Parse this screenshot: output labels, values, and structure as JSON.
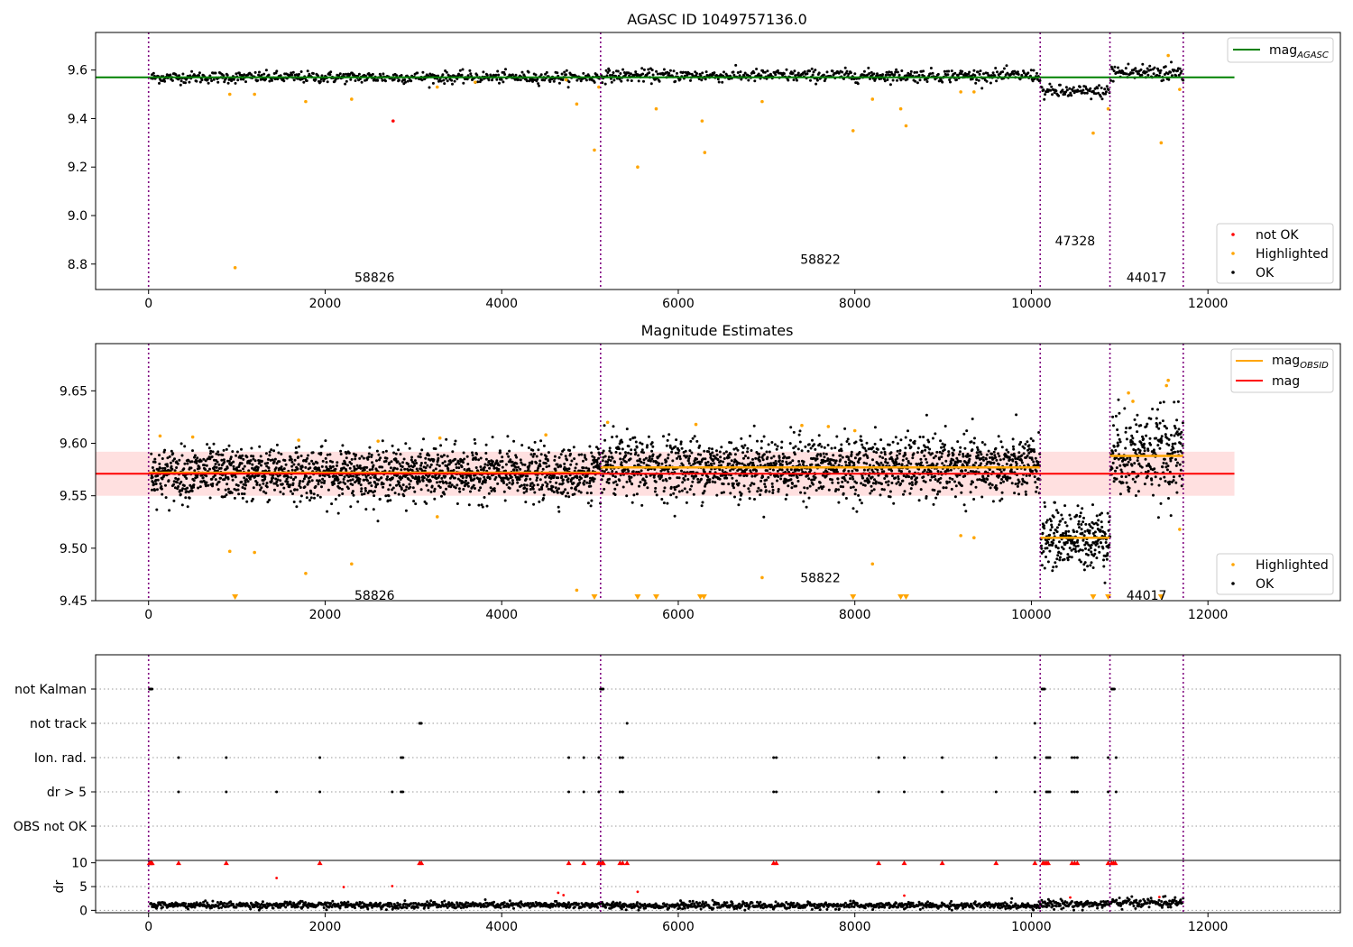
{
  "chart_data": [
    {
      "type": "scatter",
      "title": "AGASC ID 1049757136.0",
      "xlim": [
        -600,
        13500
      ],
      "ylim": [
        8.695,
        9.755
      ],
      "xticks": [
        0,
        2000,
        4000,
        6000,
        8000,
        10000,
        12000
      ],
      "yticks": [
        8.8,
        9.0,
        9.2,
        9.4,
        9.6
      ],
      "observation_boundaries": [
        0,
        5120,
        10100,
        10890,
        11720
      ],
      "observation_labels": [
        {
          "text": "58826",
          "x": 2560,
          "y": 8.745
        },
        {
          "text": "58822",
          "x": 7610,
          "y": 8.82
        },
        {
          "text": "47328",
          "x": 10495,
          "y": 8.895
        },
        {
          "text": "44017",
          "x": 11305,
          "y": 8.745
        }
      ],
      "reference_line": {
        "name": "mag_AGASC",
        "y": 9.57,
        "x_range": [
          -600,
          12300
        ],
        "color": "#008000"
      },
      "ok_segments": [
        {
          "x": [
            30,
            5120
          ],
          "center": 9.57,
          "spread": 0.012
        },
        {
          "x": [
            5130,
            10100
          ],
          "center": 9.577,
          "spread": 0.013
        },
        {
          "x": [
            10110,
            10890
          ],
          "center": 9.51,
          "spread": 0.014
        },
        {
          "x": [
            10900,
            11720
          ],
          "center": 9.59,
          "spread": 0.02
        }
      ],
      "highlighted_points": [
        [
          980,
          8.785
        ],
        [
          4850,
          9.46
        ],
        [
          5050,
          9.27
        ],
        [
          5540,
          9.2
        ],
        [
          5750,
          9.44
        ],
        [
          6270,
          9.39
        ],
        [
          6300,
          9.26
        ],
        [
          6950,
          9.47
        ],
        [
          7980,
          9.35
        ],
        [
          8200,
          9.48
        ],
        [
          8520,
          9.44
        ],
        [
          8580,
          9.37
        ],
        [
          9200,
          9.51
        ],
        [
          9350,
          9.51
        ],
        [
          10700,
          9.34
        ],
        [
          10870,
          9.44
        ],
        [
          11470,
          9.3
        ],
        [
          11550,
          9.66
        ],
        [
          11680,
          9.52
        ],
        [
          920,
          9.5
        ],
        [
          1200,
          9.5
        ],
        [
          1780,
          9.47
        ],
        [
          2300,
          9.48
        ],
        [
          3270,
          9.53
        ],
        [
          3700,
          9.55
        ],
        [
          4730,
          9.56
        ],
        [
          5100,
          9.53
        ]
      ],
      "not_ok_points": [
        [
          2770,
          9.39
        ]
      ],
      "legend_upper": [
        "mag_AGASC"
      ],
      "legend_lower": [
        "not OK",
        "Highlighted",
        "OK"
      ],
      "legend_upper_position": "upper right",
      "legend_lower_position": "lower right"
    },
    {
      "type": "scatter",
      "title": "Magnitude Estimates",
      "xlim": [
        -600,
        13500
      ],
      "ylim": [
        9.45,
        9.695
      ],
      "xticks": [
        0,
        2000,
        4000,
        6000,
        8000,
        10000,
        12000
      ],
      "yticks": [
        9.45,
        9.5,
        9.55,
        9.6,
        9.65
      ],
      "observation_boundaries": [
        0,
        5120,
        10100,
        10890,
        11720
      ],
      "observation_labels": [
        {
          "text": "58826",
          "x": 2560,
          "y": 9.455
        },
        {
          "text": "58822",
          "x": 7610,
          "y": 9.472
        },
        {
          "text": "44017",
          "x": 11305,
          "y": 9.455
        }
      ],
      "mean_line": {
        "name": "mag",
        "y": 9.571,
        "x_range": [
          -600,
          12300
        ],
        "band": [
          9.55,
          9.592
        ],
        "color": "#ff0000"
      },
      "obsid_lines": [
        {
          "x_range": [
            0,
            5120
          ],
          "y": 9.572
        },
        {
          "x_range": [
            5120,
            10100
          ],
          "y": 9.577
        },
        {
          "x_range": [
            10100,
            10890
          ],
          "y": 9.51
        },
        {
          "x_range": [
            10890,
            11720
          ],
          "y": 9.588
        }
      ],
      "ok_segments": [
        {
          "x": [
            30,
            5120
          ],
          "center": 9.571,
          "spread": 0.012
        },
        {
          "x": [
            5130,
            10100
          ],
          "center": 9.577,
          "spread": 0.014
        },
        {
          "x": [
            10110,
            10890
          ],
          "center": 9.51,
          "spread": 0.014
        },
        {
          "x": [
            10900,
            11720
          ],
          "center": 9.59,
          "spread": 0.02
        }
      ],
      "highlighted_points": [
        [
          920,
          9.497
        ],
        [
          1200,
          9.496
        ],
        [
          1780,
          9.476
        ],
        [
          2300,
          9.485
        ],
        [
          3270,
          9.53
        ],
        [
          4850,
          9.46
        ],
        [
          6950,
          9.472
        ],
        [
          8200,
          9.485
        ],
        [
          9200,
          9.512
        ],
        [
          9350,
          9.51
        ],
        [
          11680,
          9.518
        ],
        [
          11550,
          9.66
        ],
        [
          11530,
          9.655
        ],
        [
          11100,
          9.648
        ],
        [
          11150,
          9.64
        ],
        [
          6200,
          9.618
        ],
        [
          7400,
          9.617
        ],
        [
          7700,
          9.616
        ],
        [
          5200,
          9.62
        ],
        [
          130,
          9.607
        ],
        [
          500,
          9.606
        ],
        [
          1700,
          9.603
        ],
        [
          2600,
          9.602
        ],
        [
          3300,
          9.605
        ],
        [
          4500,
          9.608
        ],
        [
          8000,
          9.612
        ]
      ],
      "clipped_points_x": [
        980,
        5050,
        5540,
        5750,
        6250,
        6290,
        7980,
        8520,
        8580,
        10700,
        10870,
        11470
      ],
      "legend_upper": [
        "mag_OBSID",
        "mag"
      ],
      "legend_lower": [
        "Highlighted",
        "OK"
      ],
      "legend_upper_position": "upper right",
      "legend_lower_position": "lower right"
    },
    {
      "type": "scatter",
      "title": "",
      "xlim": [
        -600,
        13500
      ],
      "flag_rows": [
        "not Kalman",
        "not track",
        "Ion. rad.",
        "dr > 5",
        "OBS not OK"
      ],
      "observation_boundaries": [
        0,
        5120,
        10100,
        10890,
        11720
      ],
      "flags": {
        "not Kalman": [
          10,
          20,
          30,
          40,
          5120,
          5130,
          5140,
          5150,
          10120,
          10130,
          10140,
          10150,
          10910,
          10920,
          10930,
          10940
        ],
        "not track": [
          3070,
          3080,
          3090,
          5420,
          10040
        ],
        "Ion. rad.": [
          340,
          880,
          1940,
          2860,
          2880,
          4760,
          4930,
          5100,
          5340,
          5370,
          7080,
          7110,
          8270,
          8560,
          8990,
          9600,
          10040,
          10170,
          10190,
          10210,
          10460,
          10490,
          10520,
          10870,
          10960
        ],
        "dr > 5": [
          340,
          880,
          1450,
          1940,
          2760,
          2860,
          2880,
          4760,
          4930,
          5100,
          5340,
          5370,
          7080,
          7110,
          8270,
          8560,
          8990,
          9600,
          10040,
          10170,
          10190,
          10210,
          10460,
          10490,
          10520,
          10870,
          10960
        ],
        "OBS not OK": []
      }
    },
    {
      "type": "scatter",
      "title": "",
      "xlim": [
        -600,
        13500
      ],
      "ylim": [
        -0.5,
        10.5
      ],
      "yticks": [
        0,
        5,
        10
      ],
      "xticks": [
        0,
        2000,
        4000,
        6000,
        8000,
        10000,
        12000
      ],
      "ylabel": "dr",
      "ok_segments": [
        {
          "x": [
            20,
            5120
          ],
          "center": 1.1,
          "spread": 0.35
        },
        {
          "x": [
            5130,
            10100
          ],
          "center": 1.0,
          "spread": 0.35
        },
        {
          "x": [
            10110,
            10890
          ],
          "center": 1.3,
          "spread": 0.45
        },
        {
          "x": [
            10900,
            11720
          ],
          "center": 1.6,
          "spread": 0.5
        }
      ],
      "clipped_red_x": [
        10,
        20,
        30,
        40,
        340,
        880,
        1940,
        3070,
        3090,
        4760,
        4930,
        5100,
        5120,
        5140,
        5150,
        5340,
        5370,
        5420,
        7080,
        7110,
        8270,
        8560,
        8990,
        9600,
        10040,
        10130,
        10150,
        10170,
        10190,
        10460,
        10490,
        10520,
        10870,
        10910,
        10930,
        10950
      ],
      "red_points": [
        [
          1450,
          6.8
        ],
        [
          2210,
          4.9
        ],
        [
          2760,
          5.1
        ],
        [
          4640,
          3.7
        ],
        [
          4700,
          3.2
        ],
        [
          5540,
          3.9
        ],
        [
          8560,
          3.1
        ],
        [
          10440,
          2.7
        ],
        [
          11450,
          2.8
        ]
      ]
    }
  ]
}
